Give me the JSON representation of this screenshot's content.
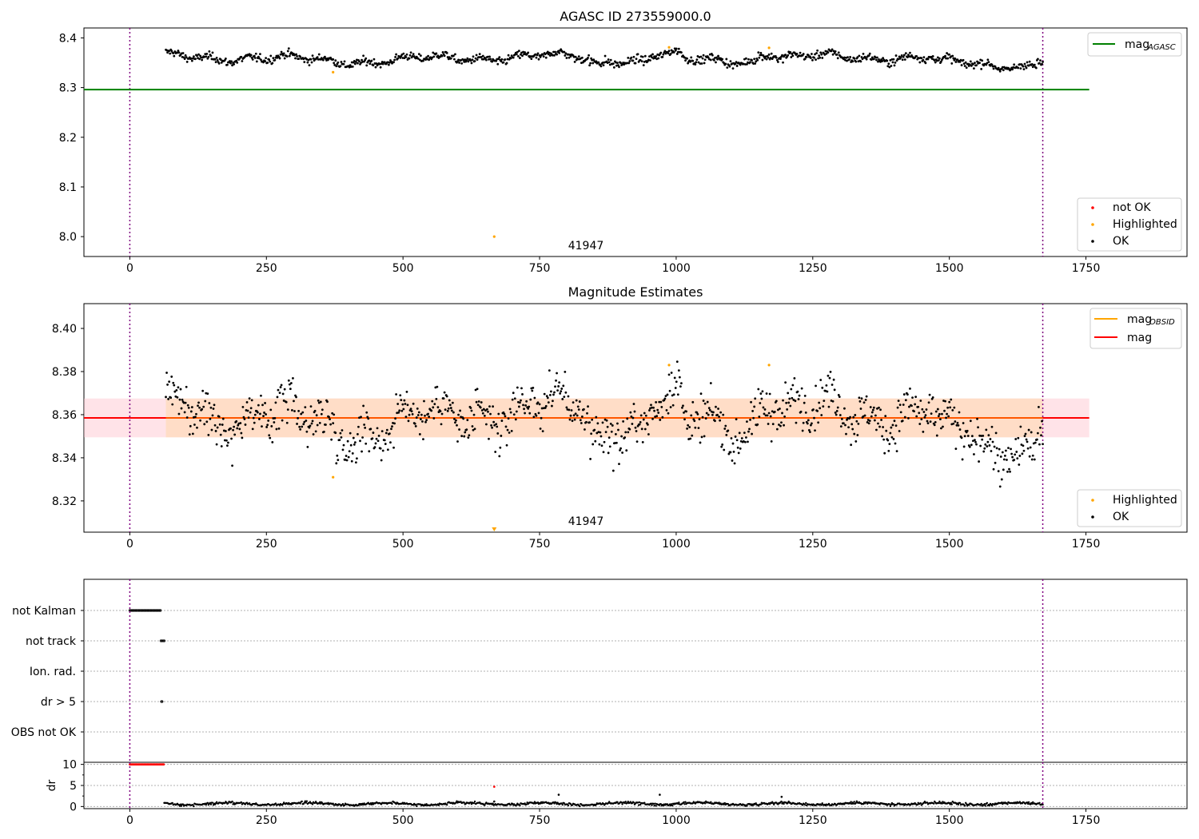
{
  "chart_data": [
    {
      "type": "scatter",
      "title": "AGASC ID 273559000.0",
      "xlim": [
        -84,
        1935
      ],
      "ylim": [
        7.96,
        8.42
      ],
      "xticks": [
        0,
        250,
        500,
        750,
        1000,
        1250,
        1500,
        1750
      ],
      "yticks": [
        "8.0",
        "8.1",
        "8.2",
        "8.3",
        "8.4"
      ],
      "ytick_values": [
        8.0,
        8.1,
        8.2,
        8.3,
        8.4
      ],
      "vlines": [
        0,
        1671
      ],
      "obsid_label": {
        "text": "41947",
        "x": 835,
        "y": 7.975
      },
      "hline": {
        "name": "mag_AGASC",
        "value": 8.296,
        "x_range": [
          -84,
          1756
        ],
        "color": "#008000"
      },
      "ok_series": {
        "name": "OK",
        "color": "#000000",
        "x_range": [
          66,
          1671
        ],
        "level": 8.36
      },
      "highlighted": {
        "name": "Highlighted",
        "color": "#ffa500",
        "points": [
          [
            372,
            8.331
          ],
          [
            667,
            8.0
          ],
          [
            987,
            8.381
          ],
          [
            1170,
            8.38
          ]
        ]
      },
      "not_ok": {
        "name": "not OK",
        "color": "#ff0000",
        "points": []
      },
      "legend_top": [
        {
          "label_main": "mag",
          "label_sub": "AGASC",
          "color": "#008000"
        }
      ],
      "legend_bottom": [
        {
          "label": "not OK",
          "color": "#ff0000"
        },
        {
          "label": "Highlighted",
          "color": "#ffa500"
        },
        {
          "label": "OK",
          "color": "#000000"
        }
      ],
      "legend_placement": [
        "upper right",
        "lower right"
      ]
    },
    {
      "type": "scatter",
      "title": "Magnitude Estimates",
      "xlim": [
        -84,
        1935
      ],
      "ylim": [
        8.3055,
        8.4115
      ],
      "xticks": [
        0,
        250,
        500,
        750,
        1000,
        1250,
        1500,
        1750
      ],
      "yticks": [
        "8.32",
        "8.34",
        "8.36",
        "8.38",
        "8.40"
      ],
      "ytick_values": [
        8.32,
        8.34,
        8.36,
        8.38,
        8.4
      ],
      "vlines": [
        0,
        1671
      ],
      "obsid_label": {
        "text": "41947",
        "x": 835,
        "y": 8.3085
      },
      "mag_line": {
        "name": "mag",
        "value": 8.3585,
        "color": "#ff0000"
      },
      "mag_band": {
        "low": 8.3495,
        "high": 8.3675,
        "color": "#ffc0cb"
      },
      "obsid_line": {
        "name": "mag_OBSID",
        "value": 8.3585,
        "color": "#ffa500"
      },
      "obsid_band": {
        "low": 8.3495,
        "high": 8.3675,
        "x_range": [
          66,
          1671
        ],
        "color": "#ffdab9"
      },
      "ok_series": {
        "name": "OK",
        "color": "#000000",
        "x_range": [
          66,
          1671
        ]
      },
      "highlighted": {
        "name": "Highlighted",
        "color": "#ffa500",
        "points": [
          [
            372,
            8.331
          ],
          [
            987,
            8.383
          ],
          [
            1170,
            8.383
          ]
        ]
      },
      "offscale_marker": {
        "x": 667,
        "color": "#ffa500"
      },
      "legend_top": [
        {
          "label_main": "mag",
          "label_sub": "OBSID",
          "color": "#ffa500"
        },
        {
          "label_main": "mag",
          "label_sub": "",
          "color": "#ff0000"
        }
      ],
      "legend_bottom": [
        {
          "label": "Highlighted",
          "color": "#ffa500"
        },
        {
          "label": "OK",
          "color": "#000000"
        }
      ],
      "legend_placement": [
        "upper right",
        "lower right"
      ]
    },
    {
      "type": "scatter",
      "title": "",
      "xlim": [
        -84,
        1935
      ],
      "categories": [
        "not Kalman",
        "not track",
        "Ion. rad.",
        "dr > 5",
        "OBS not OK"
      ],
      "flag_points": {
        "not Kalman": {
          "x_range": [
            0,
            57
          ],
          "step": 2
        },
        "not track": {
          "x_range": [
            57,
            63
          ],
          "step": 2
        },
        "Ion. rad.": null,
        "dr > 5": {
          "x_range": [
            58,
            59
          ],
          "step": 1
        },
        "OBS not OK": null
      },
      "vlines": [
        0,
        1671
      ]
    },
    {
      "type": "scatter",
      "title": "",
      "ylabel": "dr",
      "xlim": [
        -84,
        1935
      ],
      "ylim": [
        -0.5,
        10.5
      ],
      "xticks": [
        0,
        250,
        500,
        750,
        1000,
        1250,
        1500,
        1750
      ],
      "yticks": [
        "0",
        "5",
        "10"
      ],
      "ytick_values": [
        0,
        5,
        10
      ],
      "vlines": [
        0,
        1671
      ],
      "red_points": {
        "x_range": [
          0,
          63
        ],
        "value": 10,
        "color": "#ff0000"
      },
      "ok_series": {
        "x_range": [
          63,
          1671
        ],
        "color": "#000000"
      },
      "spikes": [
        [
          667,
          4.7,
          "#ff0000"
        ],
        [
          785,
          2.8,
          "#000000"
        ],
        [
          970,
          2.8,
          "#000000"
        ],
        [
          1193,
          2.3,
          "#000000"
        ],
        [
          667,
          1.2,
          "#000000"
        ]
      ]
    }
  ]
}
